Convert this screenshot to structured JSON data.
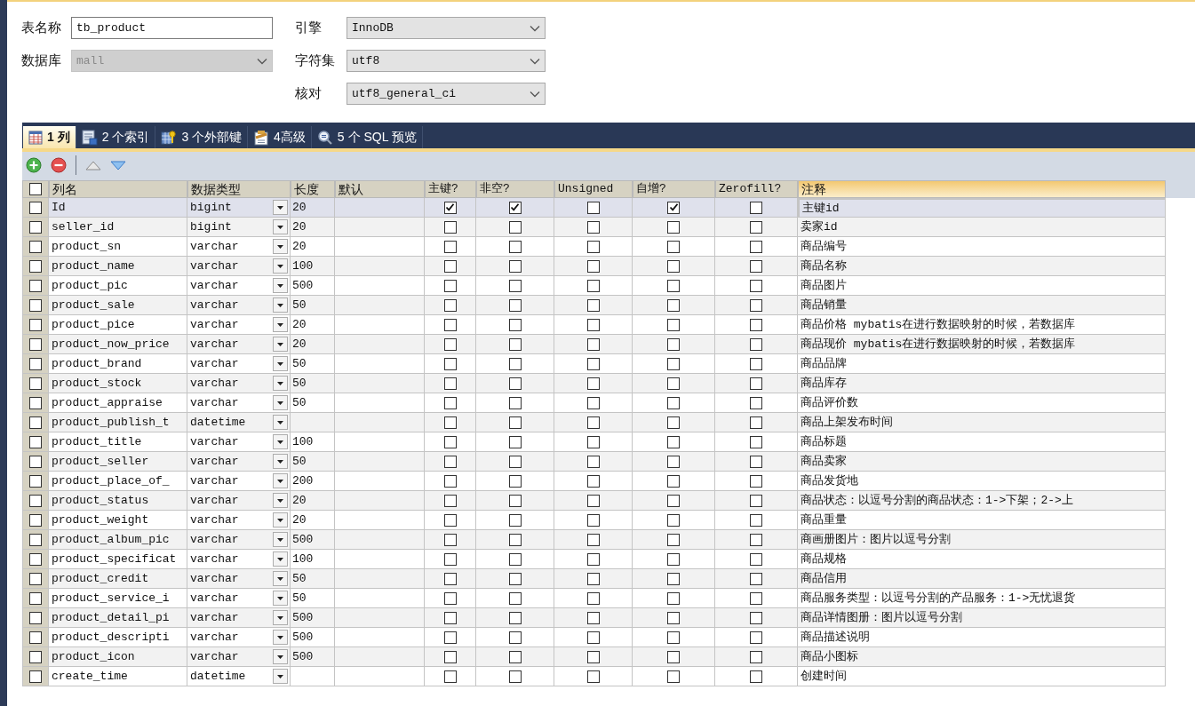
{
  "form": {
    "table_name": {
      "label": "表名称",
      "value": "tb_product"
    },
    "database": {
      "label": "数据库",
      "value": "mall",
      "disabled": true
    },
    "engine": {
      "label": "引擎",
      "value": "InnoDB",
      "disabled": false
    },
    "charset": {
      "label": "字符集",
      "value": "utf8",
      "disabled": false
    },
    "collation": {
      "label": "核对",
      "value": "utf8_general_ci",
      "disabled": false
    }
  },
  "tabs": [
    {
      "label": "1 列",
      "kind": "columns",
      "selected": true
    },
    {
      "label": "2 个索引",
      "kind": "indexes",
      "selected": false
    },
    {
      "label": "3 个外部键",
      "kind": "foreign",
      "selected": false
    },
    {
      "label": "4高级",
      "kind": "advanced",
      "selected": false
    },
    {
      "label": "5 个 SQL 预览",
      "kind": "sql",
      "selected": false
    }
  ],
  "grid": {
    "all_checked": false,
    "columns": [
      {
        "label": "列名",
        "selected": false
      },
      {
        "label": "数据类型",
        "selected": false
      },
      {
        "label": "长度",
        "selected": false
      },
      {
        "label": "默认",
        "selected": false
      },
      {
        "label": "主键?",
        "selected": false
      },
      {
        "label": "非空?",
        "selected": false
      },
      {
        "label": "Unsigned",
        "selected": false
      },
      {
        "label": "自增?",
        "selected": false
      },
      {
        "label": "Zerofill?",
        "selected": false
      },
      {
        "label": "注释",
        "selected": true
      }
    ],
    "rows": [
      {
        "checked": false,
        "selected": true,
        "name": "Id",
        "type": "bigint",
        "length": "20",
        "primary_key": true,
        "not_null": true,
        "unsigned": false,
        "auto_increment": true,
        "zerofill": false,
        "comment": "主键id"
      },
      {
        "checked": false,
        "selected": false,
        "name": "seller_id",
        "type": "bigint",
        "length": "20",
        "primary_key": false,
        "not_null": false,
        "unsigned": false,
        "auto_increment": false,
        "zerofill": false,
        "comment": "卖家id"
      },
      {
        "checked": false,
        "selected": false,
        "name": "product_sn",
        "type": "varchar",
        "length": "20",
        "primary_key": false,
        "not_null": false,
        "unsigned": false,
        "auto_increment": false,
        "zerofill": false,
        "comment": "商品编号"
      },
      {
        "checked": false,
        "selected": false,
        "name": "product_name",
        "type": "varchar",
        "length": "100",
        "primary_key": false,
        "not_null": false,
        "unsigned": false,
        "auto_increment": false,
        "zerofill": false,
        "comment": "商品名称"
      },
      {
        "checked": false,
        "selected": false,
        "name": "product_pic",
        "type": "varchar",
        "length": "500",
        "primary_key": false,
        "not_null": false,
        "unsigned": false,
        "auto_increment": false,
        "zerofill": false,
        "comment": "商品图片"
      },
      {
        "checked": false,
        "selected": false,
        "name": "product_sale",
        "type": "varchar",
        "length": "50",
        "primary_key": false,
        "not_null": false,
        "unsigned": false,
        "auto_increment": false,
        "zerofill": false,
        "comment": "商品销量"
      },
      {
        "checked": false,
        "selected": false,
        "name": "product_pice",
        "type": "varchar",
        "length": "20",
        "primary_key": false,
        "not_null": false,
        "unsigned": false,
        "auto_increment": false,
        "zerofill": false,
        "comment": "商品价格 mybatis在进行数据映射的时候，若数据库"
      },
      {
        "checked": false,
        "selected": false,
        "name": "product_now_price",
        "type": "varchar",
        "length": "20",
        "primary_key": false,
        "not_null": false,
        "unsigned": false,
        "auto_increment": false,
        "zerofill": false,
        "comment": "商品现价 mybatis在进行数据映射的时候，若数据库"
      },
      {
        "checked": false,
        "selected": false,
        "name": "product_brand",
        "type": "varchar",
        "length": "50",
        "primary_key": false,
        "not_null": false,
        "unsigned": false,
        "auto_increment": false,
        "zerofill": false,
        "comment": "商品品牌"
      },
      {
        "checked": false,
        "selected": false,
        "name": "product_stock",
        "type": "varchar",
        "length": "50",
        "primary_key": false,
        "not_null": false,
        "unsigned": false,
        "auto_increment": false,
        "zerofill": false,
        "comment": "商品库存"
      },
      {
        "checked": false,
        "selected": false,
        "name": "product_appraise",
        "type": "varchar",
        "length": "50",
        "primary_key": false,
        "not_null": false,
        "unsigned": false,
        "auto_increment": false,
        "zerofill": false,
        "comment": "商品评价数"
      },
      {
        "checked": false,
        "selected": false,
        "name": "product_publish_t",
        "type": "datetime",
        "length": "",
        "primary_key": false,
        "not_null": false,
        "unsigned": false,
        "auto_increment": false,
        "zerofill": false,
        "comment": "商品上架发布时间"
      },
      {
        "checked": false,
        "selected": false,
        "name": "product_title",
        "type": "varchar",
        "length": "100",
        "primary_key": false,
        "not_null": false,
        "unsigned": false,
        "auto_increment": false,
        "zerofill": false,
        "comment": "商品标题"
      },
      {
        "checked": false,
        "selected": false,
        "name": "product_seller",
        "type": "varchar",
        "length": "50",
        "primary_key": false,
        "not_null": false,
        "unsigned": false,
        "auto_increment": false,
        "zerofill": false,
        "comment": "商品卖家"
      },
      {
        "checked": false,
        "selected": false,
        "name": "product_place_of_",
        "type": "varchar",
        "length": "200",
        "primary_key": false,
        "not_null": false,
        "unsigned": false,
        "auto_increment": false,
        "zerofill": false,
        "comment": "商品发货地"
      },
      {
        "checked": false,
        "selected": false,
        "name": "product_status",
        "type": "varchar",
        "length": "20",
        "primary_key": false,
        "not_null": false,
        "unsigned": false,
        "auto_increment": false,
        "zerofill": false,
        "comment": "商品状态：以逗号分割的商品状态：1->下架；2->上"
      },
      {
        "checked": false,
        "selected": false,
        "name": "product_weight",
        "type": "varchar",
        "length": "20",
        "primary_key": false,
        "not_null": false,
        "unsigned": false,
        "auto_increment": false,
        "zerofill": false,
        "comment": "商品重量"
      },
      {
        "checked": false,
        "selected": false,
        "name": "product_album_pic",
        "type": "varchar",
        "length": "500",
        "primary_key": false,
        "not_null": false,
        "unsigned": false,
        "auto_increment": false,
        "zerofill": false,
        "comment": "商画册图片：图片以逗号分割"
      },
      {
        "checked": false,
        "selected": false,
        "name": "product_specificat",
        "type": "varchar",
        "length": "100",
        "primary_key": false,
        "not_null": false,
        "unsigned": false,
        "auto_increment": false,
        "zerofill": false,
        "comment": "商品规格"
      },
      {
        "checked": false,
        "selected": false,
        "name": "product_credit",
        "type": "varchar",
        "length": "50",
        "primary_key": false,
        "not_null": false,
        "unsigned": false,
        "auto_increment": false,
        "zerofill": false,
        "comment": "商品信用"
      },
      {
        "checked": false,
        "selected": false,
        "name": "product_service_i",
        "type": "varchar",
        "length": "50",
        "primary_key": false,
        "not_null": false,
        "unsigned": false,
        "auto_increment": false,
        "zerofill": false,
        "comment": "商品服务类型：以逗号分割的产品服务：1->无忧退货"
      },
      {
        "checked": false,
        "selected": false,
        "name": "product_detail_pi",
        "type": "varchar",
        "length": "500",
        "primary_key": false,
        "not_null": false,
        "unsigned": false,
        "auto_increment": false,
        "zerofill": false,
        "comment": "商品详情图册：图片以逗号分割"
      },
      {
        "checked": false,
        "selected": false,
        "name": "product_descripti",
        "type": "varchar",
        "length": "500",
        "primary_key": false,
        "not_null": false,
        "unsigned": false,
        "auto_increment": false,
        "zerofill": false,
        "comment": "商品描述说明"
      },
      {
        "checked": false,
        "selected": false,
        "name": "product_icon",
        "type": "varchar",
        "length": "500",
        "primary_key": false,
        "not_null": false,
        "unsigned": false,
        "auto_increment": false,
        "zerofill": false,
        "comment": "商品小图标"
      },
      {
        "checked": false,
        "selected": false,
        "name": "create_time",
        "type": "datetime",
        "length": "",
        "primary_key": false,
        "not_null": false,
        "unsigned": false,
        "auto_increment": false,
        "zerofill": false,
        "comment": "创建时间"
      }
    ]
  }
}
